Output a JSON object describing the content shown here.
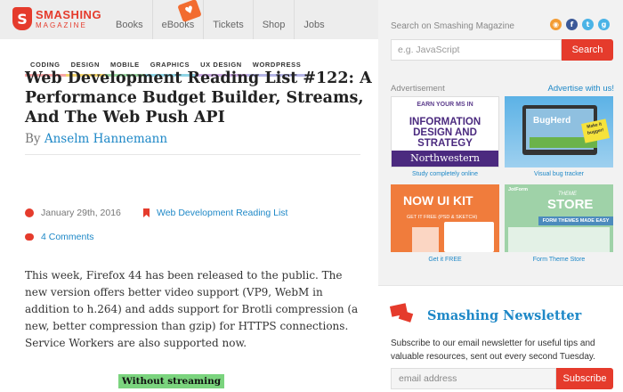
{
  "logo": {
    "mark": "S",
    "line1": "SMASHING",
    "line2": "MAGAZINE"
  },
  "nav": {
    "items": [
      "Books",
      "eBooks",
      "Tickets",
      "Shop",
      "Jobs"
    ],
    "cat_badge": "♥"
  },
  "categories": [
    "CODING",
    "DESIGN",
    "MOBILE",
    "GRAPHICS",
    "UX DESIGN",
    "WORDPRESS"
  ],
  "article": {
    "title": "Web Development Reading List #122: A Performance Budget Builder, Streams, And The Web Push API",
    "by_prefix": "By",
    "author": "Anselm Hannemann",
    "date": "January 29th, 2016",
    "category_link": "Web Development Reading List",
    "comments": "4 Comments",
    "body": "This week, Firefox 44 has been released to the public. The new version offers better video support (VP9, WebM in addition to h.264) and adds support for Brotli compression (a new, better compression than gzip) for HTTPS connections. Service Workers are also supported now.",
    "figure_label": "Without streaming"
  },
  "sidebar": {
    "search_label": "Search on Smashing Magazine",
    "search_placeholder": "e.g. JavaScript",
    "search_button": "Search",
    "social": [
      {
        "icon": "rss-icon",
        "glyph": "◉",
        "color": "#f39c34"
      },
      {
        "icon": "facebook-icon",
        "glyph": "f",
        "color": "#3b5998"
      },
      {
        "icon": "twitter-icon",
        "glyph": "t",
        "color": "#4ab3e6"
      },
      {
        "icon": "google-plus-icon",
        "glyph": "g",
        "color": "#4ab3e6"
      }
    ],
    "ad_label": "Advertisement",
    "ad_link": "Advertise with us!",
    "ads": [
      {
        "line1": "EARN YOUR MS IN",
        "line2a": "INFORMATION",
        "line2b": "DESIGN AND",
        "line2c": "STRATEGY",
        "line3": "Northwestern",
        "caption": "Study completely online"
      },
      {
        "brand": "BugHerd",
        "sticker": "Make it bugger!",
        "caption": "Visual bug tracker"
      },
      {
        "title": "NOW UI KIT",
        "sub": "GET IT FREE (PSD & SKETCH)",
        "caption": "Get it FREE"
      },
      {
        "brand": "JotForm",
        "theme": "THEME",
        "store": "STORE",
        "bar": "FORM THEMES MADE EASY",
        "caption": "Form Theme Store"
      }
    ]
  },
  "newsletter": {
    "title": "Smashing Newsletter",
    "description": "Subscribe to our email newsletter for useful tips and valuable resources, sent out every second Tuesday.",
    "placeholder": "email address",
    "button": "Subscribe"
  },
  "colors": {
    "accent": "#e53b2c",
    "link": "#1e88c7"
  }
}
